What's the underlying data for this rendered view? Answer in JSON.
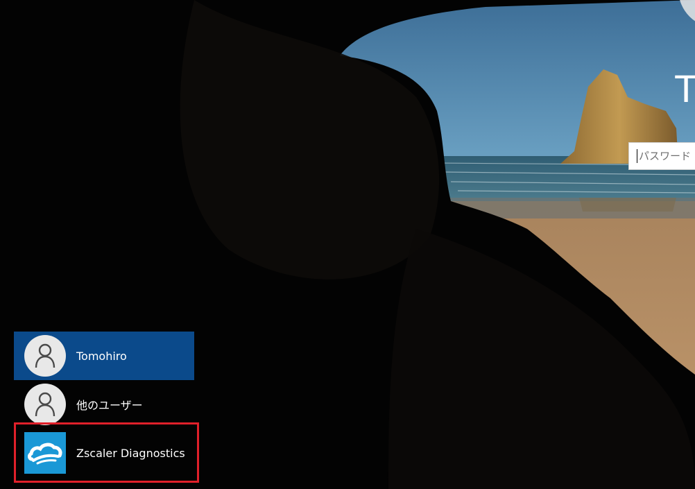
{
  "lock_screen": {
    "username_partial": "T",
    "password": {
      "placeholder": "パスワード",
      "value": ""
    }
  },
  "user_list": {
    "items": [
      {
        "label": "Tomohiro",
        "icon": "user-person-icon",
        "selected": true
      },
      {
        "label": "他のユーザー",
        "icon": "user-person-icon",
        "selected": false
      },
      {
        "label": "Zscaler Diagnostics",
        "icon": "zscaler-cloud-icon",
        "selected": false
      }
    ]
  },
  "colors": {
    "selected_item": "#0b4a8b",
    "highlight_border": "#e0202a",
    "zscaler_brand": "#1a98d6",
    "sky": "#4b7fa8",
    "sand": "#c0956a"
  }
}
